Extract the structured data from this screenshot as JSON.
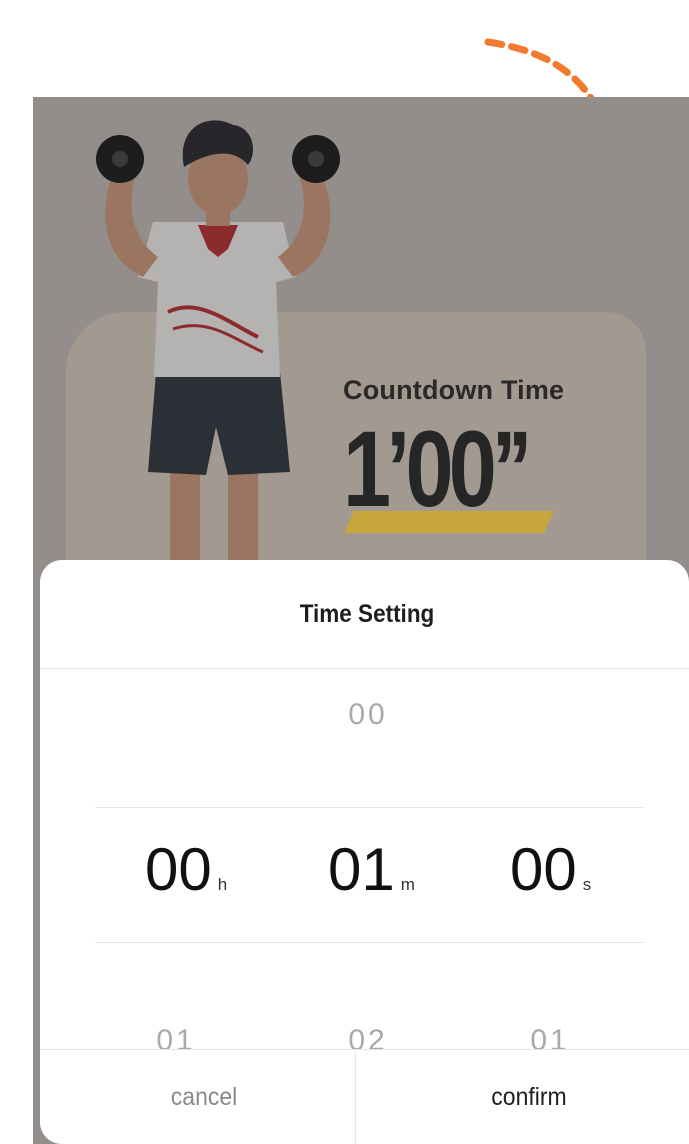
{
  "countdown": {
    "label": "Countdown Time",
    "value": "1’00’’"
  },
  "time_setting_sheet": {
    "title": "Time Setting",
    "above_row": {
      "hours": "00"
    },
    "selected_row": {
      "hours": "00",
      "hours_unit": "h",
      "minutes": "01",
      "minutes_unit": "m",
      "seconds": "00",
      "seconds_unit": "s"
    },
    "below_row": {
      "hours": "01",
      "minutes": "02",
      "seconds": "01"
    },
    "cancel_label": "cancel",
    "confirm_label": "confirm"
  },
  "colors": {
    "overlay_bg": "#938e8b",
    "hint_arrow": "#f07a2e",
    "highlight_bar": "#c9a53e"
  },
  "icons": {
    "hint_arrow": "dashed-curved-arrow-icon",
    "illustration": "weightlifter-illustration"
  }
}
